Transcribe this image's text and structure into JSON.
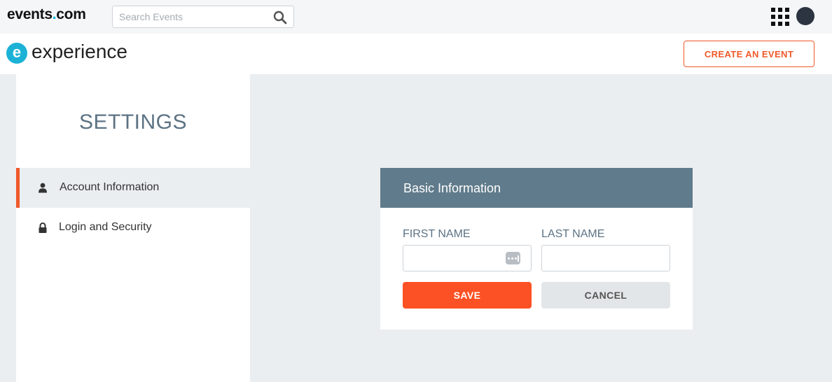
{
  "topbar": {
    "brand_prefix": "events",
    "brand_dot": ".",
    "brand_suffix": "com",
    "search_placeholder": "Search Events",
    "search_icon": "search-icon",
    "apps_icon": "grid-icon",
    "avatar_icon": "avatar"
  },
  "header": {
    "logo_letter": "e",
    "title": "experience",
    "create_button": "CREATE AN EVENT"
  },
  "sidebar": {
    "title": "SETTINGS",
    "items": [
      {
        "label": "Account Information",
        "icon": "user-icon",
        "active": true
      },
      {
        "label": "Login and Security",
        "icon": "lock-icon",
        "active": false
      }
    ]
  },
  "card": {
    "title": "Basic Information",
    "first_name_label": "FIRST NAME",
    "first_name_value": "",
    "last_name_label": "LAST NAME",
    "last_name_value": "",
    "save_label": "SAVE",
    "cancel_label": "CANCEL"
  },
  "colors": {
    "accent": "#f0592a",
    "save_button": "#fc5124",
    "card_header": "#607b8b",
    "brand_dot": "#00b3d4",
    "logo_circle": "#1bb2d6",
    "settings_text": "#5c7384",
    "page_background": "#ebeef1"
  }
}
